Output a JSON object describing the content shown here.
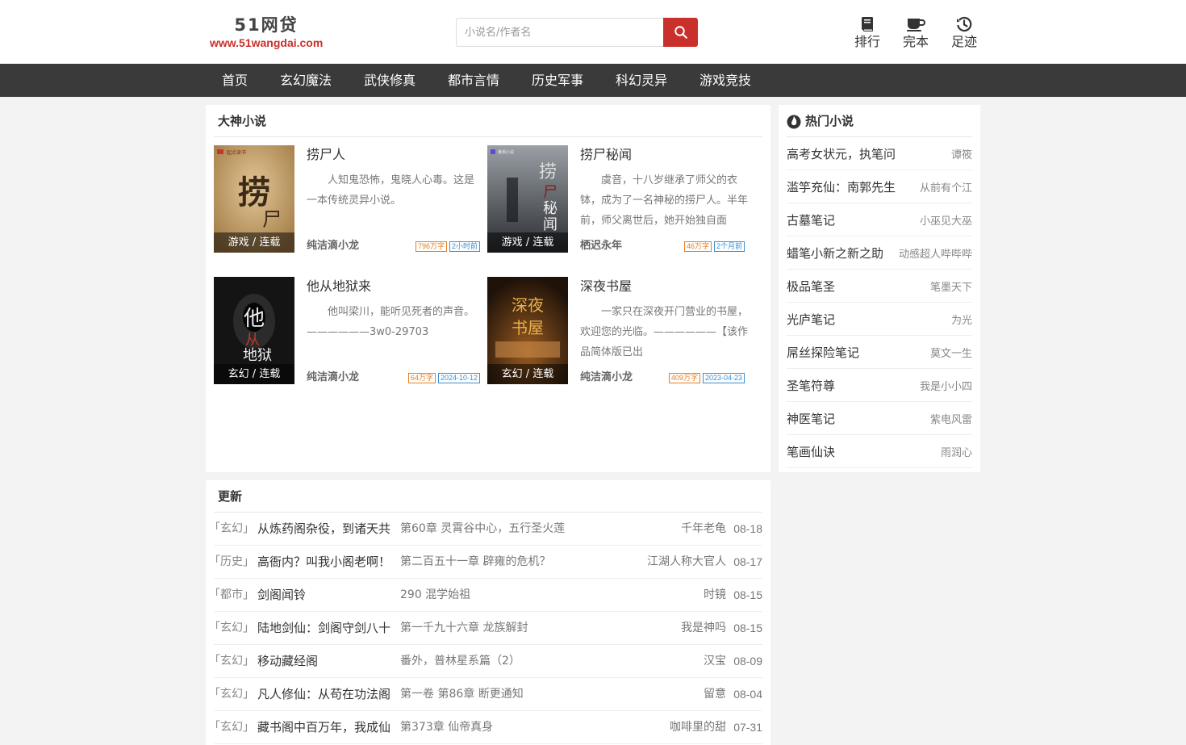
{
  "site": {
    "name": "51网贷",
    "url": "www.51wangdai.com"
  },
  "search": {
    "placeholder": "小说名/作者名"
  },
  "quick_links": [
    {
      "label": "排行",
      "icon": "book-icon"
    },
    {
      "label": "完本",
      "icon": "coffee-cup-icon"
    },
    {
      "label": "足迹",
      "icon": "history-icon"
    }
  ],
  "nav": [
    "首页",
    "玄幻魔法",
    "武侠修真",
    "都市言情",
    "历史军事",
    "科幻灵异",
    "游戏竞技"
  ],
  "featured": {
    "title": "大神小说",
    "books": [
      {
        "title": "捞尸人",
        "tag": "游戏 / 连载",
        "desc": "人知鬼恐怖，鬼晓人心毒。这是一本传统灵异小说。",
        "author": "纯洁滴小龙",
        "words": "796万字",
        "updated": "2小时前",
        "cover_text": "捞尸人"
      },
      {
        "title": "捞尸秘闻",
        "tag": "游戏 / 连载",
        "desc": "虞音，十八岁继承了师父的衣钵，成为了一名神秘的捞尸人。半年前，师父离世后，她开始独自面",
        "author": "栖迟永年",
        "words": "46万字",
        "updated": "2个月前",
        "cover_text": "捞尸秘闻"
      },
      {
        "title": "他从地狱来",
        "tag": "玄幻 / 连载",
        "desc": "他叫梁川，能听见死者的声音。——————3w0-29703",
        "author": "纯洁滴小龙",
        "words": "64万字",
        "updated": "2024-10-12",
        "cover_text": "他从地狱来"
      },
      {
        "title": "深夜书屋",
        "tag": "玄幻 / 连载",
        "desc": "一家只在深夜开门营业的书屋，　　欢迎您的光临。——————【该作品简体版已出",
        "author": "纯洁滴小龙",
        "words": "409万字",
        "updated": "2023-04-23",
        "cover_text": "深夜书屋"
      }
    ]
  },
  "hot": {
    "title": "热门小说",
    "items": [
      {
        "title": "高考女状元，执笔问",
        "author": "谭筱"
      },
      {
        "title": "滥竽充仙：南郭先生",
        "author": "从前有个江"
      },
      {
        "title": "古墓笔记",
        "author": "小巫见大巫"
      },
      {
        "title": "蜡笔小新之新之助",
        "author": "动感超人哔哔哔"
      },
      {
        "title": "极品笔圣",
        "author": "笔墨天下"
      },
      {
        "title": "光庐笔记",
        "author": "为光"
      },
      {
        "title": "屌丝探险笔记",
        "author": "莫文一生"
      },
      {
        "title": "圣笔符尊",
        "author": "我是小小四"
      },
      {
        "title": "神医笔记",
        "author": "紫电风雷"
      },
      {
        "title": "笔画仙诀",
        "author": "雨润心"
      }
    ]
  },
  "updates": {
    "title": "更新",
    "items": [
      {
        "category": "「玄幻」",
        "title": "从炼药阁杂役，到诸天共",
        "chapter": "第60章 灵霄谷中心，五行圣火莲",
        "author": "千年老龟",
        "date": "08-18"
      },
      {
        "category": "「历史」",
        "title": "高衙内？叫我小阁老啊！",
        "chapter": "第二百五十一章 辟雍的危机？",
        "author": "江湖人称大官人",
        "date": "08-17"
      },
      {
        "category": "「都市」",
        "title": "剑阁闻铃",
        "chapter": "290 混学始祖",
        "author": "时镜",
        "date": "08-15"
      },
      {
        "category": "「玄幻」",
        "title": "陆地剑仙：剑阁守剑八十",
        "chapter": "第一千九十六章 龙族解封",
        "author": "我是神吗",
        "date": "08-15"
      },
      {
        "category": "「玄幻」",
        "title": "移动藏经阁",
        "chapter": "番外，普林星系篇（2）",
        "author": "汉宝",
        "date": "08-09"
      },
      {
        "category": "「玄幻」",
        "title": "凡人修仙：从苟在功法阁",
        "chapter": "第一卷 第86章 断更通知",
        "author": "留意",
        "date": "08-04"
      },
      {
        "category": "「玄幻」",
        "title": "藏书阁中百万年，我成仙",
        "chapter": "第373章 仙帝真身",
        "author": "咖啡里的甜",
        "date": "07-31"
      }
    ]
  },
  "colors": {
    "accent": "#c9302c",
    "nav_bg": "#3a3a3a"
  }
}
